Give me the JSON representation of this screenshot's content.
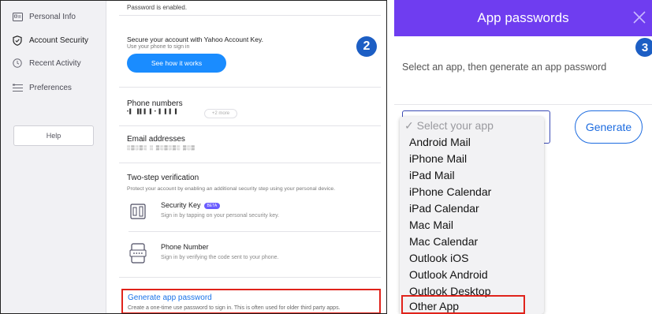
{
  "left": {
    "sidebar": {
      "items": [
        {
          "label": "Personal Info",
          "icon": "id-card-icon"
        },
        {
          "label": "Account Security",
          "icon": "shield-icon"
        },
        {
          "label": "Recent Activity",
          "icon": "clock-icon"
        },
        {
          "label": "Preferences",
          "icon": "list-icon"
        }
      ],
      "help_label": "Help"
    },
    "content": {
      "enabled_text": "Password is enabled.",
      "account_key": {
        "title": "Secure your account with Yahoo Account Key.",
        "subtitle": "Use your phone to sign in",
        "button_label": "See how it works"
      },
      "step_badge": "2",
      "phone_numbers": {
        "title": "Phone numbers",
        "value": "•▌ ▐▌▌▐ • ▌▐ ▌▐",
        "more_label": "+2 more"
      },
      "email_addresses": {
        "title": "Email addresses",
        "value": "░▒░▒░ ░ ▒░▒░▒░ ▒░▒"
      },
      "two_step": {
        "title": "Two-step verification",
        "subtitle": "Protect your account by enabling an additional security step using your personal device.",
        "options": [
          {
            "title": "Security Key",
            "badge": "BETA",
            "subtitle": "Sign in by tapping on your personal security key.",
            "icon": "security-key-icon"
          },
          {
            "title": "Phone Number",
            "subtitle": "Sign in by verifying the code sent to your phone.",
            "icon": "phone-code-icon"
          }
        ]
      },
      "app_password": {
        "title": "Generate app password",
        "subtitle": "Create a one-time use password to sign in. This is often used for older third party apps."
      }
    }
  },
  "right": {
    "header": {
      "title": "App passwords"
    },
    "step_badge": "3",
    "instruction": "Select an app, then generate an app password",
    "generate_label": "Generate",
    "dropdown": {
      "placeholder": "✓ Select your app",
      "options": [
        "Android Mail",
        "iPhone Mail",
        "iPad Mail",
        "iPhone Calendar",
        "iPad Calendar",
        "Mac Mail",
        "Mac Calendar",
        "Outlook iOS",
        "Outlook Android",
        "Outlook Desktop",
        "Other App"
      ],
      "highlighted": "Other App"
    }
  },
  "colors": {
    "brand_purple": "#6f3df0",
    "accent_blue": "#1a8cff",
    "link_blue": "#1a73e8",
    "highlight_red": "#e0231b",
    "badge_blue": "#1c5ec4"
  }
}
